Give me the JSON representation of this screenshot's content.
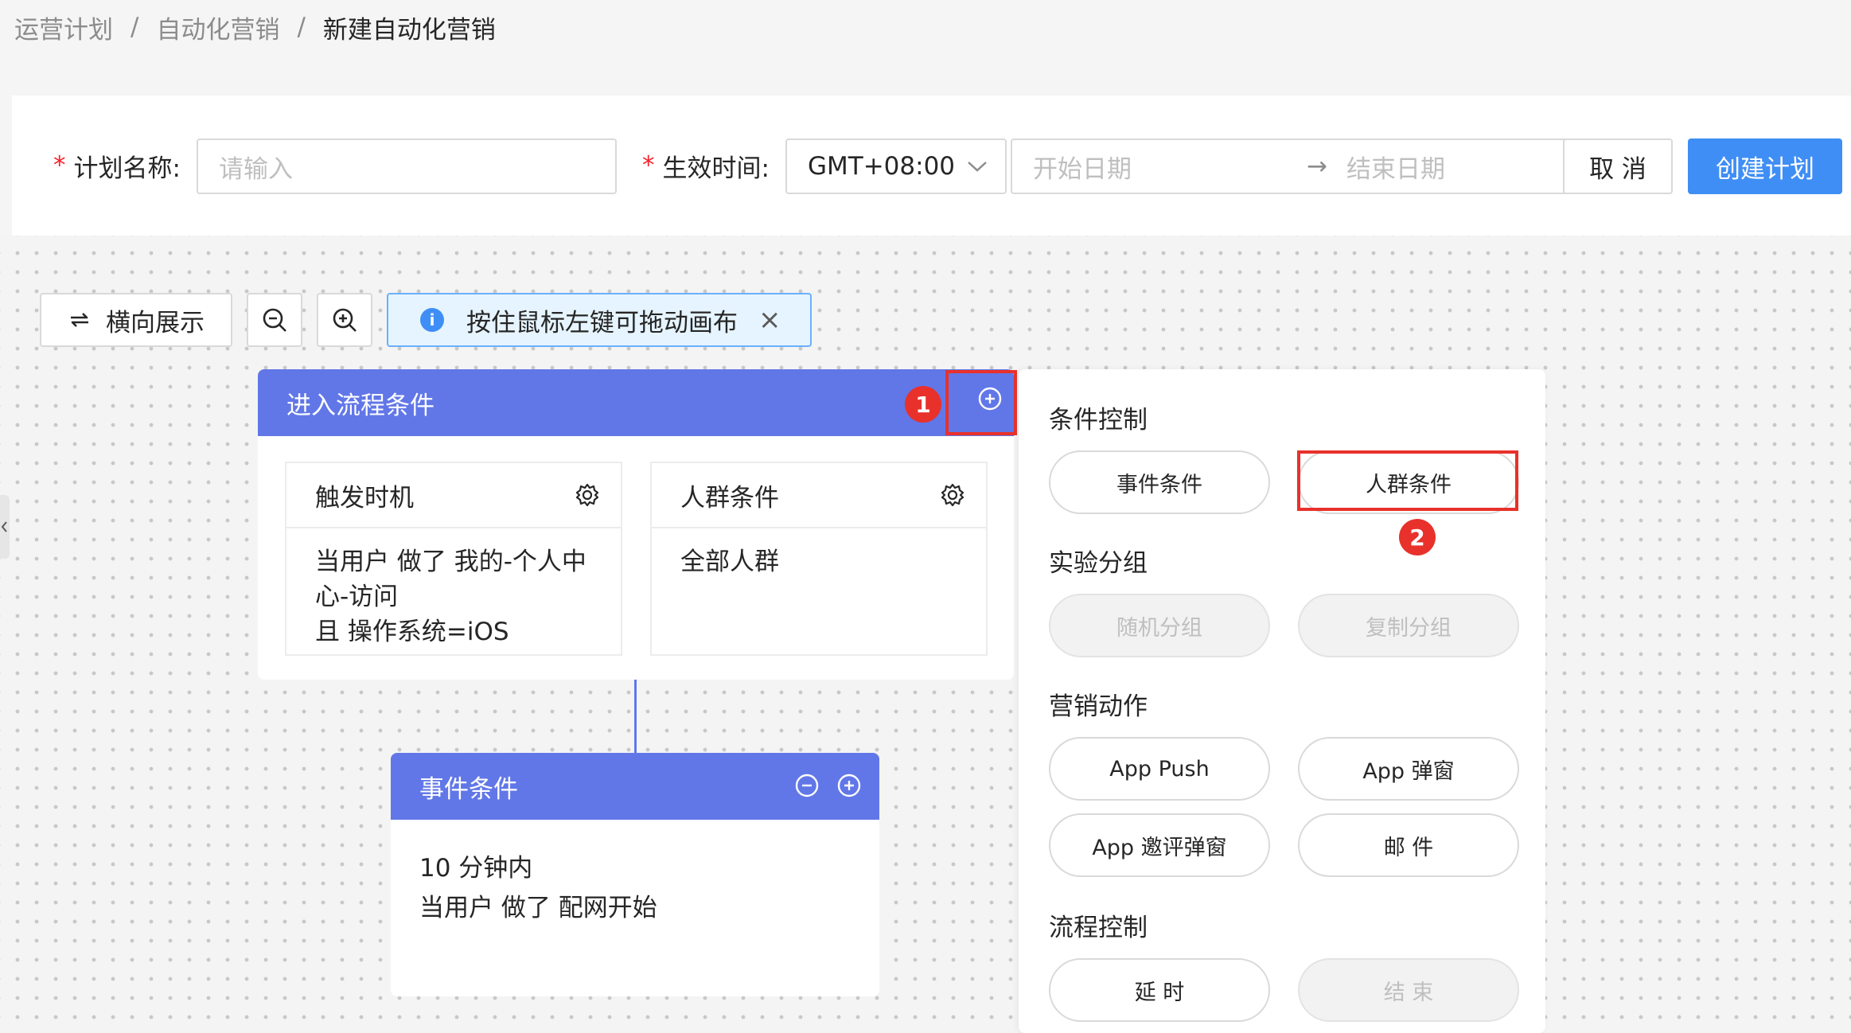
{
  "breadcrumb": {
    "items": [
      "运营计划",
      "自动化营销"
    ],
    "current": "新建自动化营销",
    "separator": "/"
  },
  "form": {
    "plan_name_label": "计划名称:",
    "plan_name_placeholder": "请输入",
    "effective_time_label": "生效时间:",
    "timezone_value": "GMT+08:00",
    "start_date_placeholder": "开始日期",
    "range_arrow": "→",
    "end_date_placeholder": "结束日期",
    "cancel_label": "取 消",
    "create_label": "创建计划",
    "required_mark": "*"
  },
  "toolbar": {
    "horizontal_label": "横向展示",
    "info_text": "按住鼠标左键可拖动画布",
    "info_icon": "i",
    "close_icon": "×"
  },
  "entry_node": {
    "title": "进入流程条件",
    "trigger_card": {
      "title": "触发时机",
      "lines": [
        "当用户 做了 我的-个人中",
        "心-访问",
        "且 操作系统=iOS"
      ]
    },
    "crowd_card": {
      "title": "人群条件",
      "lines": [
        "全部人群"
      ]
    }
  },
  "event_node": {
    "title": "事件条件",
    "lines": [
      "10 分钟内",
      "当用户 做了 配网开始"
    ]
  },
  "panel": {
    "sections": [
      {
        "title": "条件控制",
        "buttons": [
          {
            "label": "事件条件",
            "disabled": false
          },
          {
            "label": "人群条件",
            "disabled": false
          }
        ]
      },
      {
        "title": "实验分组",
        "buttons": [
          {
            "label": "随机分组",
            "disabled": true
          },
          {
            "label": "复制分组",
            "disabled": true
          }
        ]
      },
      {
        "title": "营销动作",
        "buttons": [
          {
            "label": "App Push",
            "disabled": false
          },
          {
            "label": "App 弹窗",
            "disabled": false
          },
          {
            "label": "App 邀评弹窗",
            "disabled": false
          },
          {
            "label": "邮 件",
            "disabled": false
          }
        ]
      },
      {
        "title": "流程控制",
        "buttons": [
          {
            "label": "延 时",
            "disabled": false
          },
          {
            "label": "结 束",
            "disabled": true
          }
        ]
      }
    ]
  },
  "annotations": {
    "badge_1": "1",
    "badge_2": "2"
  },
  "colors": {
    "primary": "#3f8ef5",
    "node_header": "#6177e8",
    "annotation_red": "#e8312b"
  }
}
